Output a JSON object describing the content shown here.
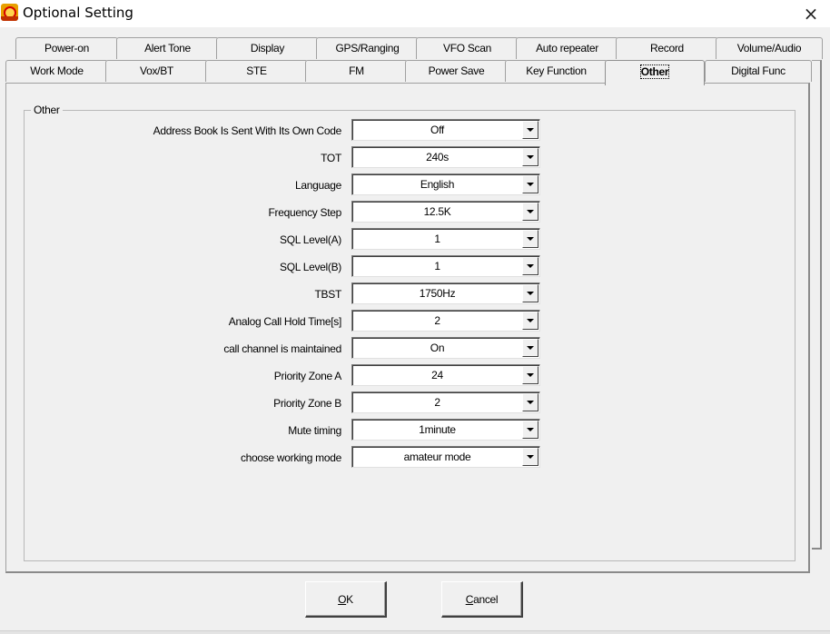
{
  "window": {
    "title": "Optional Setting",
    "close_glyph": "×"
  },
  "tabs_row_top": [
    {
      "label": "Power-on"
    },
    {
      "label": "Alert Tone"
    },
    {
      "label": "Display"
    },
    {
      "label": "GPS/Ranging"
    },
    {
      "label": "VFO Scan"
    },
    {
      "label": "Auto repeater"
    },
    {
      "label": "Record"
    },
    {
      "label": "Volume/Audio"
    }
  ],
  "tabs_row_bottom": [
    {
      "label": "Work Mode"
    },
    {
      "label": "Vox/BT"
    },
    {
      "label": "STE"
    },
    {
      "label": "FM"
    },
    {
      "label": "Power Save"
    },
    {
      "label": "Key Function"
    },
    {
      "label": "Other",
      "active": true
    },
    {
      "label": "Digital Func"
    }
  ],
  "group": {
    "label": "Other"
  },
  "settings": [
    {
      "label": "Address Book Is Sent With Its Own Code",
      "value": "Off"
    },
    {
      "label": "TOT",
      "value": "240s"
    },
    {
      "label": "Language",
      "value": "English"
    },
    {
      "label": "Frequency Step",
      "value": "12.5K"
    },
    {
      "label": "SQL Level(A)",
      "value": "1"
    },
    {
      "label": "SQL Level(B)",
      "value": "1"
    },
    {
      "label": "TBST",
      "value": "1750Hz"
    },
    {
      "label": "Analog Call Hold Time[s]",
      "value": "2"
    },
    {
      "label": "call channel is maintained",
      "value": "On"
    },
    {
      "label": "Priority Zone A",
      "value": "24"
    },
    {
      "label": "Priority Zone B",
      "value": "2"
    },
    {
      "label": "Mute timing",
      "value": "1minute"
    },
    {
      "label": "choose working mode",
      "value": "amateur mode"
    }
  ],
  "buttons": {
    "ok": {
      "mnemonic": "O",
      "rest": "K"
    },
    "cancel": {
      "mnemonic": "C",
      "rest": "ancel"
    }
  },
  "icons": {
    "app": "app-logo-icon",
    "close": "close-icon",
    "dropdown": "arrow-down-icon"
  }
}
